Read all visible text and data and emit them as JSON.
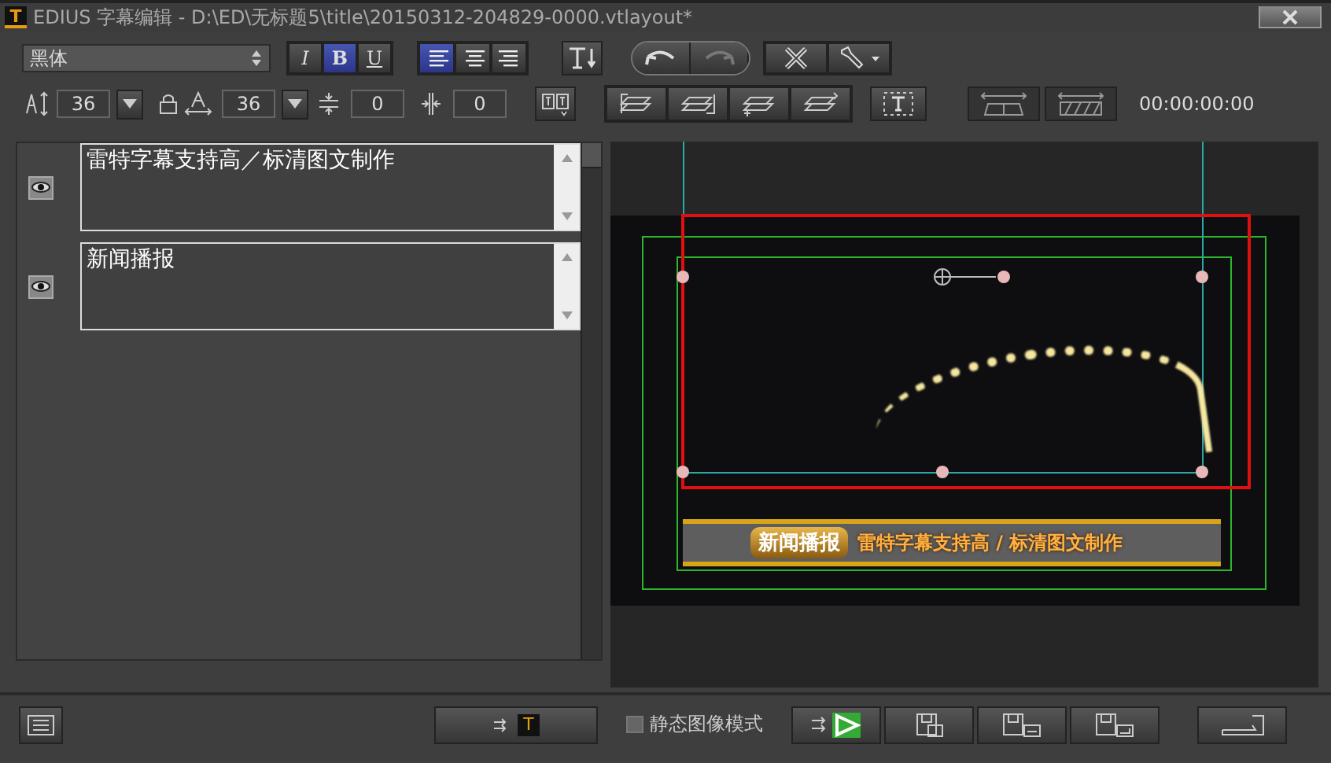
{
  "window": {
    "app_icon": "T",
    "title": "EDIUS 字幕编辑 - D:\\ED\\无标题5\\title\\20150312-204829-0000.vtlayout*"
  },
  "toolbar": {
    "font": "黑体",
    "style_buttons": [
      {
        "label": "I",
        "kind": "italic",
        "selected": false
      },
      {
        "label": "B",
        "kind": "bold",
        "selected": true
      },
      {
        "label": "U",
        "kind": "underline",
        "selected": false
      }
    ],
    "align_buttons": [
      {
        "kind": "left",
        "selected": true
      },
      {
        "kind": "center",
        "selected": false
      },
      {
        "kind": "right",
        "selected": false
      }
    ],
    "font_size": "36",
    "width_size": "36",
    "line_spacing": "0",
    "char_spacing": "0",
    "timecode": "00:00:00:00"
  },
  "tracks": [
    {
      "text": "雷特字幕支持高／标清图文制作",
      "visible": true
    },
    {
      "text": "新闻播报",
      "visible": true
    }
  ],
  "preview": {
    "badge": "新闻播报",
    "caption": "雷特字幕支持高 / 标清图文制作"
  },
  "footer": {
    "export_glyph": "T",
    "still_mode": {
      "label": "静态图像模式",
      "checked": false
    }
  }
}
